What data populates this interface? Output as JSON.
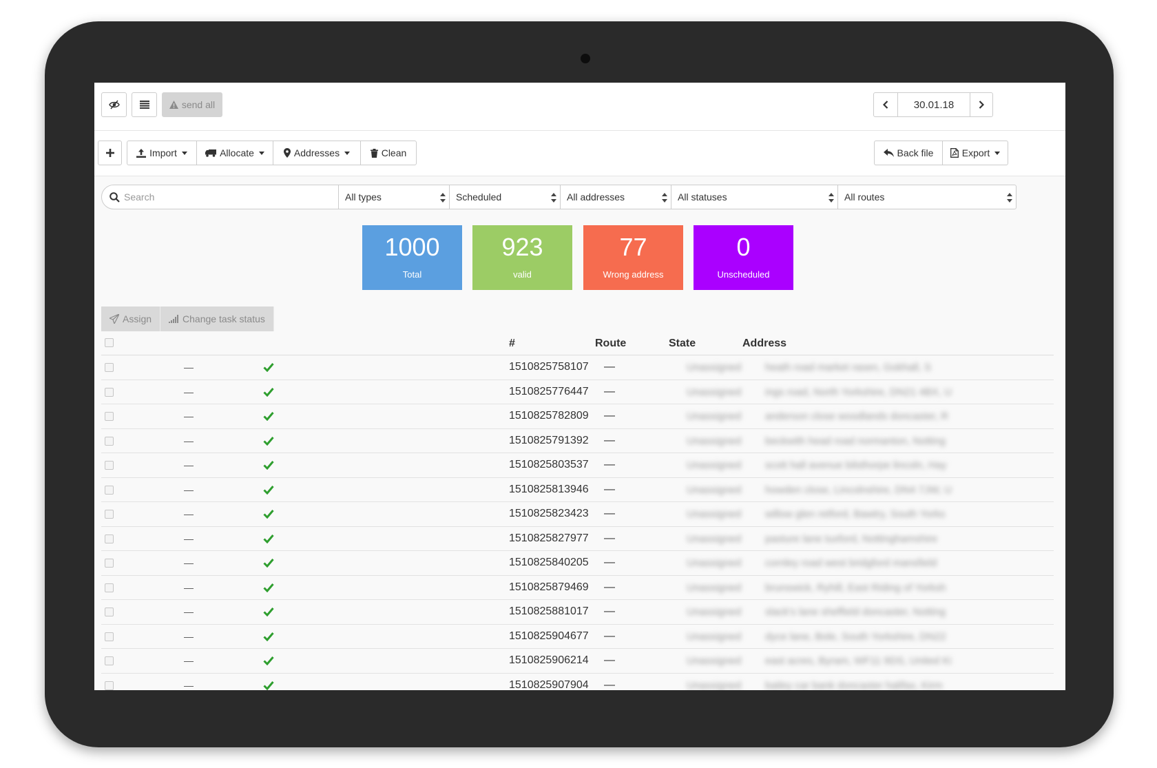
{
  "toolbar": {
    "send_all_label": "send all",
    "date": "30.01.18"
  },
  "actions_bar": {
    "import_label": "Import",
    "allocate_label": "Allocate",
    "addresses_label": "Addresses",
    "clean_label": "Clean",
    "back_file_label": "Back file",
    "export_label": "Export"
  },
  "filters": {
    "search_placeholder": "Search",
    "types": "All types",
    "schedule": "Scheduled",
    "addresses": "All addresses",
    "statuses": "All statuses",
    "routes": "All routes"
  },
  "stats": [
    {
      "value": "1000",
      "label": "Total",
      "color": "#5b9fe0"
    },
    {
      "value": "923",
      "label": "valid",
      "color": "#9ccc65"
    },
    {
      "value": "77",
      "label": "Wrong address",
      "color": "#f66c4f"
    },
    {
      "value": "0",
      "label": "Unscheduled",
      "color": "#aa00ff"
    }
  ],
  "task_actions": {
    "assign_label": "Assign",
    "change_status_label": "Change task status"
  },
  "table": {
    "columns": [
      "#",
      "Route",
      "State",
      "Address"
    ],
    "rows": [
      {
        "dash": "—",
        "id": "1510825758107",
        "route": "—",
        "state": "Unassigned",
        "address": "heath road market rasen, Gokhall, S"
      },
      {
        "dash": "—",
        "id": "1510825776447",
        "route": "—",
        "state": "Unassigned",
        "address": "ings road, North Yorkshire, DN21 4BX, U"
      },
      {
        "dash": "—",
        "id": "1510825782809",
        "route": "—",
        "state": "Unassigned",
        "address": "anderson close woodlands doncaster, R"
      },
      {
        "dash": "—",
        "id": "1510825791392",
        "route": "—",
        "state": "Unassigned",
        "address": "beckwith head road normanton, Notting"
      },
      {
        "dash": "—",
        "id": "1510825803537",
        "route": "—",
        "state": "Unassigned",
        "address": "scott hall avenue bilsthorpe lincoln, Hay"
      },
      {
        "dash": "—",
        "id": "1510825813946",
        "route": "—",
        "state": "Unassigned",
        "address": "howden close, Lincolnshire, DN4 7JW, U"
      },
      {
        "dash": "—",
        "id": "1510825823423",
        "route": "—",
        "state": "Unassigned",
        "address": "willow glen retford, Bawtry, South Yorks"
      },
      {
        "dash": "—",
        "id": "1510825827977",
        "route": "—",
        "state": "Unassigned",
        "address": "pasture lane tuxford, Nottinghamshire"
      },
      {
        "dash": "—",
        "id": "1510825840205",
        "route": "—",
        "state": "Unassigned",
        "address": "cornley road west bridgford mansfield"
      },
      {
        "dash": "—",
        "id": "1510825879469",
        "route": "—",
        "state": "Unassigned",
        "address": "brunswick, Ryhill, East Riding of Yorksh"
      },
      {
        "dash": "—",
        "id": "1510825881017",
        "route": "—",
        "state": "Unassigned",
        "address": "slack's lane sheffield doncaster, Notting"
      },
      {
        "dash": "—",
        "id": "1510825904677",
        "route": "—",
        "state": "Unassigned",
        "address": "dyce lane, Bole, South Yorkshire, DN22"
      },
      {
        "dash": "—",
        "id": "1510825906214",
        "route": "—",
        "state": "Unassigned",
        "address": "east acres, Byram, WF11 9DS, United Ki"
      },
      {
        "dash": "—",
        "id": "1510825907904",
        "route": "—",
        "state": "Unassigned",
        "address": "bailey car bank doncaster halifax, Kirm"
      }
    ]
  }
}
